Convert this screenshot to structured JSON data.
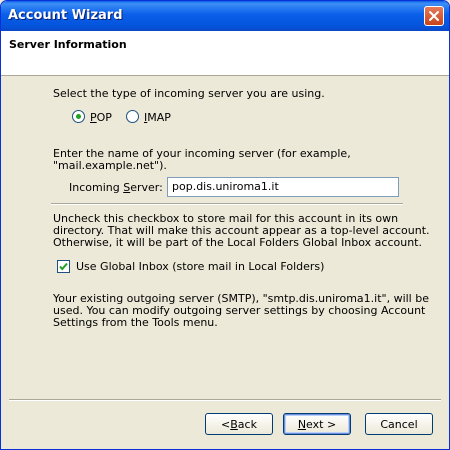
{
  "window": {
    "title": "Account Wizard"
  },
  "header": {
    "title": "Server Information"
  },
  "server_type": {
    "prompt": "Select the type of incoming server you are using.",
    "options": [
      {
        "label_pre": "",
        "label_u": "P",
        "label_post": "OP",
        "selected": true
      },
      {
        "label_pre": "",
        "label_u": "I",
        "label_post": "MAP",
        "selected": false
      }
    ]
  },
  "incoming": {
    "prompt_line1": "Enter the name of your incoming server (for example,",
    "prompt_line2": "\"mail.example.net\").",
    "label_pre": "Incoming ",
    "label_u": "S",
    "label_post": "erver:",
    "value": "pop.dis.uniroma1.it"
  },
  "global_inbox": {
    "desc_line1": "Uncheck this checkbox to store mail for this account in its own",
    "desc_line2": "directory. That will make this account appear as a top-level account.",
    "desc_line3": "Otherwise, it will be part of the Local Folders Global Inbox account.",
    "checkbox_label": "Use Global Inbox (store mail in Local Folders)",
    "checked": true
  },
  "outgoing": {
    "line1": "Your existing outgoing server (SMTP), \"smtp.dis.uniroma1.it\", will be",
    "line2": "used. You can modify outgoing server settings by choosing Account",
    "line3": "Settings from the Tools menu."
  },
  "buttons": {
    "back_pre": "< ",
    "back_u": "B",
    "back_post": "ack",
    "next_u": "N",
    "next_post": "ext >",
    "cancel": "Cancel"
  },
  "icons": {
    "close": "close-icon",
    "check": "checkmark-icon"
  }
}
